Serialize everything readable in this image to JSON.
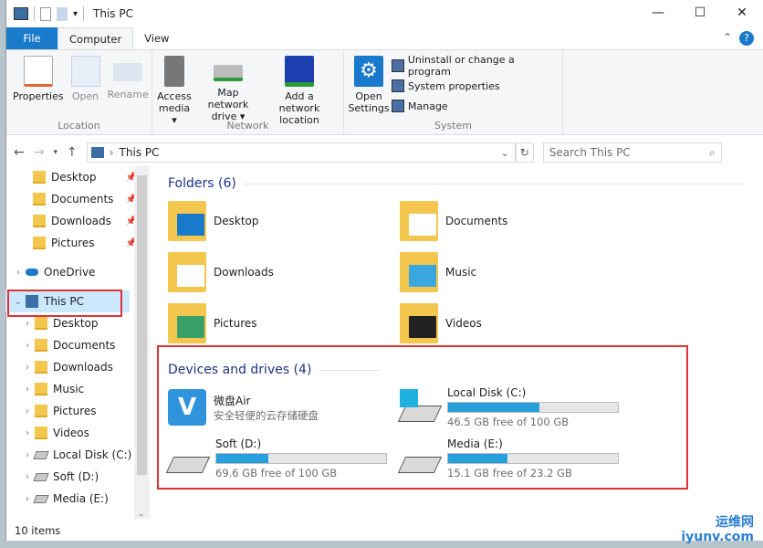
{
  "window": {
    "title": "This PC",
    "minimize": "—",
    "maximize": "☐",
    "close": "✕"
  },
  "tabs": [
    {
      "label": "File"
    },
    {
      "label": "Computer"
    },
    {
      "label": "View"
    }
  ],
  "help": "?",
  "ribbon": {
    "location": {
      "label": "Location",
      "items": [
        "Properties",
        "Open",
        "Rename"
      ]
    },
    "network": {
      "label": "Network",
      "items": [
        "Access media ▾",
        "Map network drive ▾",
        "Add a network location"
      ]
    },
    "system": {
      "label": "System",
      "open_settings": "Open Settings",
      "items": [
        "Uninstall or change a program",
        "System properties",
        "Manage"
      ]
    }
  },
  "address": {
    "path": "This PC",
    "search_placeholder": "Search This PC"
  },
  "sidebar": {
    "quick": [
      {
        "label": "Desktop"
      },
      {
        "label": "Documents"
      },
      {
        "label": "Downloads"
      },
      {
        "label": "Pictures"
      }
    ],
    "onedrive": "OneDrive",
    "thispc": "This PC",
    "children": [
      {
        "label": "Desktop"
      },
      {
        "label": "Documents"
      },
      {
        "label": "Downloads"
      },
      {
        "label": "Music"
      },
      {
        "label": "Pictures"
      },
      {
        "label": "Videos"
      },
      {
        "label": "Local Disk (C:)"
      },
      {
        "label": "Soft (D:)"
      },
      {
        "label": "Media (E:)"
      }
    ]
  },
  "folders": {
    "header": "Folders (6)",
    "items": [
      {
        "label": "Desktop"
      },
      {
        "label": "Documents"
      },
      {
        "label": "Downloads"
      },
      {
        "label": "Music"
      },
      {
        "label": "Pictures"
      },
      {
        "label": "Videos"
      }
    ]
  },
  "devices": {
    "header": "Devices and drives (4)",
    "weipan": {
      "name": "微盘Air",
      "sub": "安全轻便的云存储硬盘"
    },
    "drives": [
      {
        "name": "Local Disk (C:)",
        "free": "46.5 GB free of 100 GB",
        "used_pct": 53.5
      },
      {
        "name": "Soft (D:)",
        "free": "69.6 GB free of 100 GB",
        "used_pct": 30.4
      },
      {
        "name": "Media (E:)",
        "free": "15.1 GB free of 23.2 GB",
        "used_pct": 34.9
      }
    ]
  },
  "status": "10 items",
  "watermark": {
    "line1": "运维网",
    "line2": "iyunv.com"
  },
  "colors": {
    "accent": "#1979ca",
    "bar": "#26a0da",
    "highlight": "#dd3333"
  }
}
